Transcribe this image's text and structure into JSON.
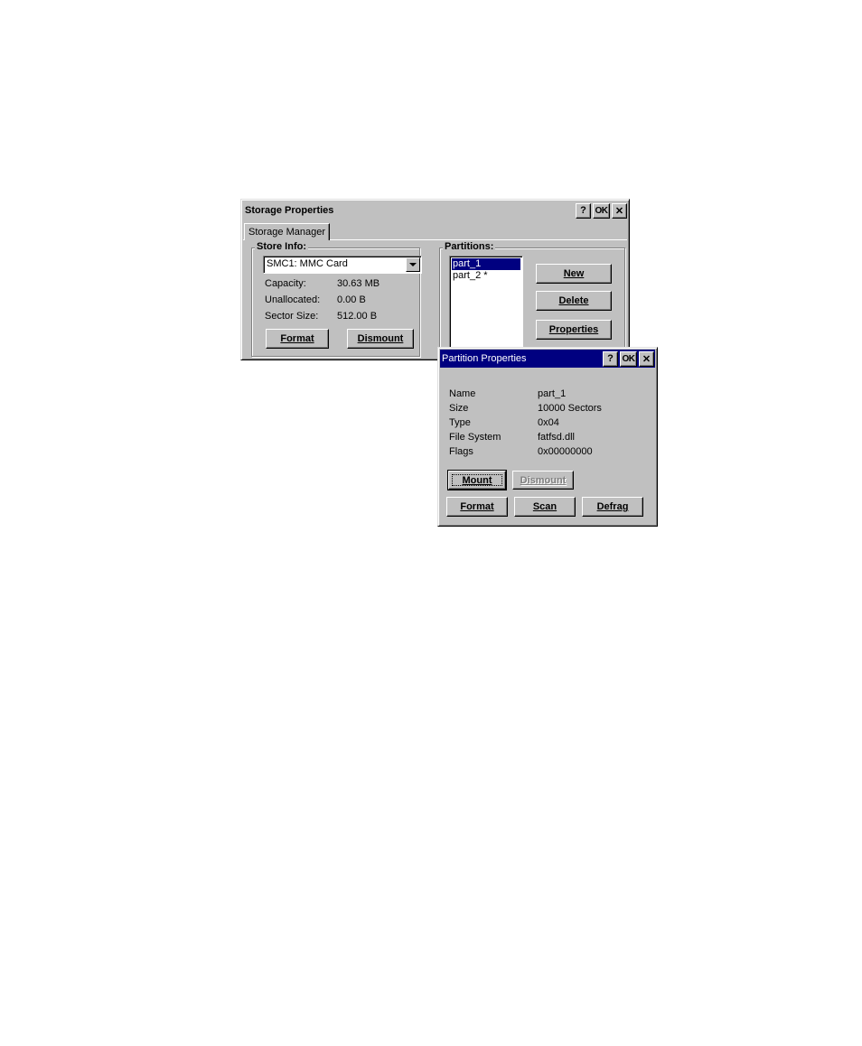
{
  "storage_dialog": {
    "title": "Storage Properties",
    "help_label": "?",
    "ok_label": "OK",
    "close_label": "✕",
    "tab_label": "Storage Manager",
    "store_info": {
      "group_label": "Store Info:",
      "selected_store": "SMC1: MMC Card",
      "capacity_label": "Capacity:",
      "capacity_value": "30.63 MB",
      "unallocated_label": "Unallocated:",
      "unallocated_value": "0.00 B",
      "sector_size_label": "Sector Size:",
      "sector_size_value": "512.00 B",
      "format_button": "Format",
      "dismount_button": "Dismount"
    },
    "partitions": {
      "group_label": "Partitions:",
      "items": [
        "part_1",
        "part_2 *"
      ],
      "selected_index": 0,
      "new_button": "New",
      "delete_button": "Delete",
      "properties_button": "Properties"
    }
  },
  "partition_dialog": {
    "title": "Partition Properties",
    "help_label": "?",
    "ok_label": "OK",
    "close_label": "✕",
    "fields": [
      {
        "label": "Name",
        "value": "part_1"
      },
      {
        "label": "Size",
        "value": "10000 Sectors"
      },
      {
        "label": "Type",
        "value": "0x04"
      },
      {
        "label": "File System",
        "value": "fatfsd.dll"
      },
      {
        "label": "Flags",
        "value": "0x00000000"
      }
    ],
    "mount_button": "Mount",
    "dismount_button": "Dismount",
    "format_button": "Format",
    "scan_button": "Scan",
    "defrag_button": "Defrag"
  },
  "colors": {
    "face": "#c0c0c0",
    "title_active": "#000080",
    "selection": "#000080"
  }
}
